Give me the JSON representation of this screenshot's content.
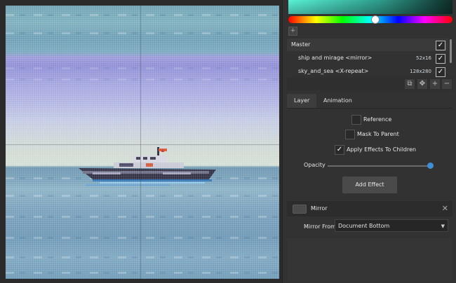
{
  "layers": {
    "items": [
      {
        "name": "Master",
        "size": "",
        "checked": "✓"
      },
      {
        "name": "ship and mirage <mirror>",
        "size": "52x16",
        "checked": "✓"
      },
      {
        "name": "sky_and_sea <X-repeat>",
        "size": "128x280",
        "checked": "✓"
      }
    ]
  },
  "toolbar": {
    "copy": "⧉",
    "move": "✥",
    "add": "+",
    "remove": "−"
  },
  "swatch": {
    "add": "+"
  },
  "tabs": [
    {
      "label": "Layer"
    },
    {
      "label": "Animation"
    }
  ],
  "options": {
    "reference": {
      "label": "Reference",
      "mark": ""
    },
    "mask_to_parent": {
      "label": "Mask To Parent",
      "mark": ""
    },
    "apply_effects": {
      "label": "Apply Effects To Children",
      "mark": "✓"
    }
  },
  "opacity": {
    "label": "Opacity",
    "value": 1.0
  },
  "add_effect": {
    "label": "Add Effect"
  },
  "effect": {
    "name": "Mirror",
    "close": "✕",
    "mirror_from_label": "Mirror From",
    "mirror_from_value": "Document Bottom",
    "arrow": "▼"
  },
  "colors": {
    "accent": "#4d8fc9",
    "slider": "#3f8fd8",
    "color_preview": "#5af2d8"
  },
  "icons": [
    "checkmark-icon",
    "copy-icon",
    "move-icon",
    "plus-icon",
    "minus-icon",
    "close-icon",
    "chevron-down-icon"
  ]
}
